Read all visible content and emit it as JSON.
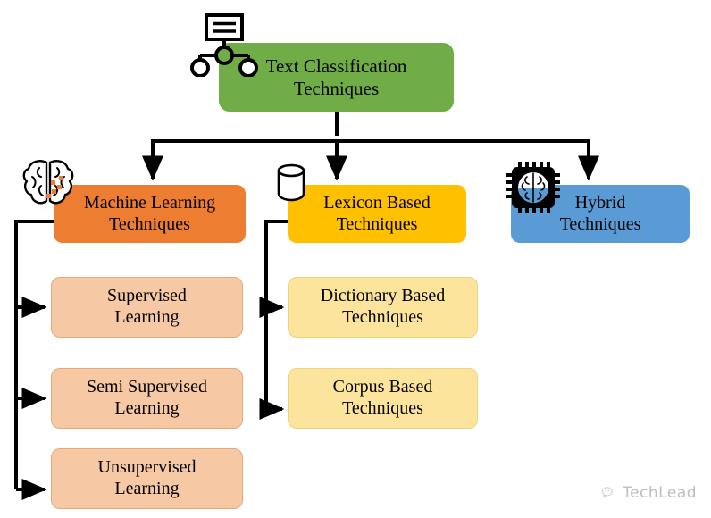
{
  "diagram": {
    "title": "Text Classification Techniques",
    "type": "hierarchy-tree",
    "colors": {
      "root": "#70AD47",
      "machine_learning": "#ED7D31",
      "machine_learning_child": "#F6C9A4",
      "lexicon": "#FFC000",
      "lexicon_child": "#FCE49C",
      "hybrid": "#5B9BD5",
      "connector": "#000000",
      "background": "#FFFFFF",
      "watermark": "#BDBDBD"
    }
  },
  "root": {
    "label": "Text Classification\nTechniques",
    "icon": "sitemap-icon"
  },
  "branches": [
    {
      "id": "machine-learning",
      "label": "Machine Learning\nTechniques",
      "icon": "brain-icon",
      "children": [
        {
          "id": "supervised-learning",
          "label": "Supervised\nLearning"
        },
        {
          "id": "semi-supervised-learning",
          "label": "Semi Supervised\nLearning"
        },
        {
          "id": "unsupervised-learning",
          "label": "Unsupervised\nLearning"
        }
      ]
    },
    {
      "id": "lexicon-based",
      "label": "Lexicon Based\nTechniques",
      "icon": "database-icon",
      "children": [
        {
          "id": "dictionary-based",
          "label": "Dictionary Based\nTechniques"
        },
        {
          "id": "corpus-based",
          "label": "Corpus Based\nTechniques"
        }
      ]
    },
    {
      "id": "hybrid",
      "label": "Hybrid\nTechniques",
      "icon": "ai-chip-icon",
      "children": []
    }
  ],
  "watermark": {
    "text": "TechLead",
    "icon": "wechat-icon"
  }
}
